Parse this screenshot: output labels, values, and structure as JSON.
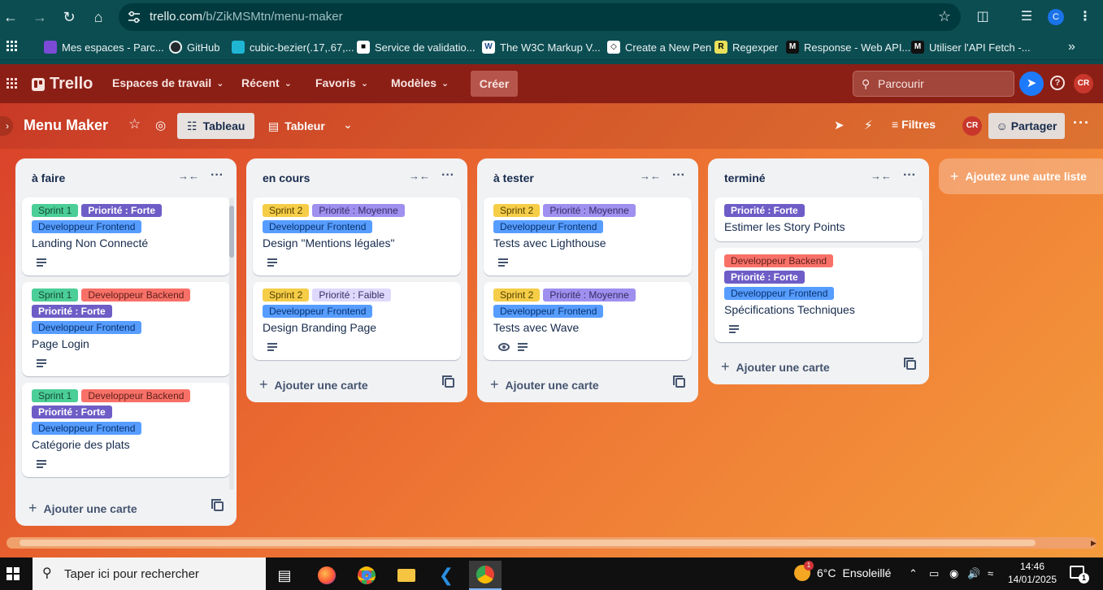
{
  "browser": {
    "url_host": "trello.com",
    "url_path": "/b/ZikMSMtn/menu-maker",
    "profile_initial": "C",
    "bookmarks": [
      {
        "label": "Mes espaces - Parc...",
        "icon": "space-icon",
        "color": "#7b4bd6"
      },
      {
        "label": "GitHub",
        "icon": "github-icon",
        "color": "#24292e"
      },
      {
        "label": "cubic-bezier(.17,.67,...",
        "icon": "curve-icon",
        "color": "#1fb6d4"
      },
      {
        "label": "Service de validatio...",
        "icon": "validator-icon",
        "color": "#ffffff"
      },
      {
        "label": "The W3C Markup V...",
        "icon": "w3c-icon",
        "color": "#ffffff"
      },
      {
        "label": "Create a New Pen",
        "icon": "codepen-icon",
        "color": "#ffffff"
      },
      {
        "label": "Regexper",
        "icon": "regexper-icon",
        "color": "#e8e05a"
      },
      {
        "label": "Response - Web API...",
        "icon": "mdn-icon",
        "color": "#111111"
      },
      {
        "label": "Utiliser l'API Fetch -...",
        "icon": "mdn-icon",
        "color": "#111111"
      }
    ],
    "bookmarks_overflow": "»"
  },
  "header": {
    "brand": "Trello",
    "menus": [
      "Espaces de travail",
      "Récent",
      "Favoris",
      "Modèles"
    ],
    "create_label": "Créer",
    "search_placeholder": "Parcourir",
    "avatar_initials": "CR"
  },
  "board": {
    "title": "Menu Maker",
    "views": [
      "Tableau",
      "Tableur"
    ],
    "filters_label": "Filtres",
    "share_label": "Partager",
    "avatar_initials": "CR",
    "add_list_label": "Ajoutez une autre liste",
    "lists": [
      {
        "title": "à faire",
        "add_card_label": "Ajouter une carte",
        "cards": [
          {
            "labels": [
              {
                "text": "Sprint 1",
                "color": "green"
              },
              {
                "text": "Priorité : Forte",
                "color": "purple-dark"
              },
              {
                "text": "Developpeur Frontend",
                "color": "blue"
              }
            ],
            "title": "Landing Non Connecté",
            "description": true,
            "watch": false
          },
          {
            "labels": [
              {
                "text": "Sprint 1",
                "color": "green"
              },
              {
                "text": "Developpeur Backend",
                "color": "red"
              },
              {
                "text": "Priorité : Forte",
                "color": "purple-dark"
              },
              {
                "text": "Developpeur Frontend",
                "color": "blue"
              }
            ],
            "title": "Page Login",
            "description": true,
            "watch": false
          },
          {
            "labels": [
              {
                "text": "Sprint 1",
                "color": "green"
              },
              {
                "text": "Developpeur Backend",
                "color": "red"
              },
              {
                "text": "Priorité : Forte",
                "color": "purple-dark"
              },
              {
                "text": "Developpeur Frontend",
                "color": "blue"
              }
            ],
            "title": "Catégorie des plats",
            "description": true,
            "watch": false
          }
        ]
      },
      {
        "title": "en cours",
        "add_card_label": "Ajouter une carte",
        "cards": [
          {
            "labels": [
              {
                "text": "Sprint 2",
                "color": "yellow"
              },
              {
                "text": "Priorité : Moyenne",
                "color": "purple"
              },
              {
                "text": "Developpeur Frontend",
                "color": "blue"
              }
            ],
            "title": "Design \"Mentions légales\"",
            "description": true,
            "watch": false
          },
          {
            "labels": [
              {
                "text": "Sprint 2",
                "color": "yellow"
              },
              {
                "text": "Priorité : Faible",
                "color": "purple-light"
              },
              {
                "text": "Developpeur Frontend",
                "color": "blue"
              }
            ],
            "title": "Design Branding Page",
            "description": true,
            "watch": false
          }
        ]
      },
      {
        "title": "à tester",
        "add_card_label": "Ajouter une carte",
        "cards": [
          {
            "labels": [
              {
                "text": "Sprint 2",
                "color": "yellow"
              },
              {
                "text": "Priorité : Moyenne",
                "color": "purple"
              },
              {
                "text": "Developpeur Frontend",
                "color": "blue"
              }
            ],
            "title": "Tests avec Lighthouse",
            "description": true,
            "watch": false
          },
          {
            "labels": [
              {
                "text": "Sprint 2",
                "color": "yellow"
              },
              {
                "text": "Priorité : Moyenne",
                "color": "purple"
              },
              {
                "text": "Developpeur Frontend",
                "color": "blue"
              }
            ],
            "title": "Tests avec Wave",
            "description": true,
            "watch": true
          }
        ]
      },
      {
        "title": "terminé",
        "add_card_label": "Ajouter une carte",
        "cards": [
          {
            "labels": [
              {
                "text": "Priorité : Forte",
                "color": "purple-dark"
              }
            ],
            "title": "Estimer les Story Points",
            "description": false,
            "watch": false
          },
          {
            "labels": [
              {
                "text": "Developpeur Backend",
                "color": "red"
              },
              {
                "text": "Priorité : Forte",
                "color": "purple-dark"
              },
              {
                "text": "Developpeur Frontend",
                "color": "blue"
              }
            ],
            "title": "Spécifications Techniques",
            "description": true,
            "watch": false
          }
        ]
      }
    ]
  },
  "taskbar": {
    "search_placeholder": "Taper ici pour rechercher",
    "weather_temp": "6°C",
    "weather_text": "Ensoleillé",
    "weather_badge": "1",
    "time": "14:46",
    "date": "14/01/2025",
    "notification_count": "1"
  },
  "colors": {
    "header_bg": "#8b1f16",
    "board_gradient_start": "#d9412a",
    "board_gradient_end": "#f49b3d",
    "browser_bg": "#0c4d52"
  }
}
